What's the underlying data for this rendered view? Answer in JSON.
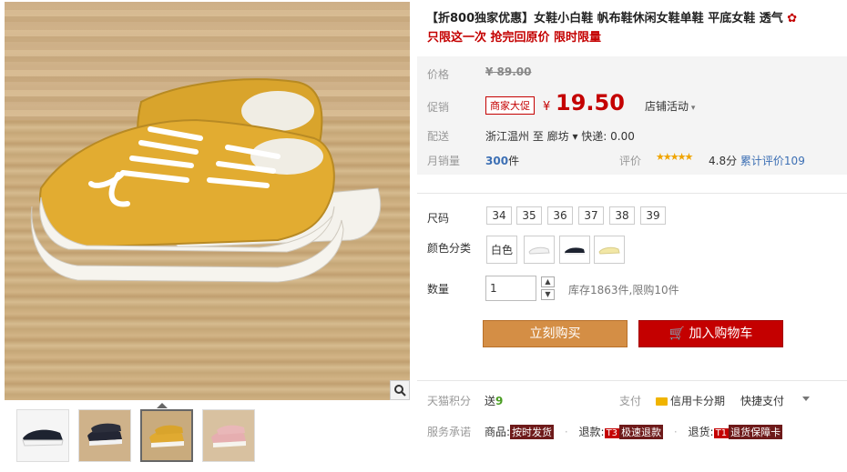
{
  "product": {
    "title": "【折800独家优惠】女鞋小白鞋 帆布鞋休闲女鞋单鞋 平底女鞋 透气",
    "subtitle": "只限这一次 抢完回原价 限时限量"
  },
  "price": {
    "label": "价格",
    "original": "¥ 89.00",
    "promo_label": "促销",
    "promo_tag": "商家大促",
    "yen": "¥",
    "current": "19.50",
    "shop_activity": "店铺活动"
  },
  "shipping": {
    "label": "配送",
    "text": "浙江温州  至  廊坊 ▾  快递: 0.00"
  },
  "sales": {
    "label": "月销量",
    "count": "300",
    "unit": "件",
    "review_label": "评价",
    "stars": "★★★★★",
    "score": "4.8分",
    "total_reviews": "累计评价109"
  },
  "options": {
    "size_label": "尺码",
    "sizes": [
      "34",
      "35",
      "36",
      "37",
      "38",
      "39"
    ],
    "color_label": "颜色分类",
    "color_first": "白色",
    "qty_label": "数量",
    "qty_value": "1",
    "stock_text": "库存1863件,限购10件"
  },
  "actions": {
    "buy_now": "立刻购买",
    "add_cart": "加入购物车"
  },
  "footer": {
    "points_label": "天猫积分",
    "points_prefix": "送",
    "points_value": "9",
    "pay_label": "支付",
    "credit": "信用卡分期",
    "quickpay": "快捷支付",
    "service_label": "服务承诺",
    "svc1_prefix": "商品:",
    "svc1_tag": "按时发货",
    "svc2_prefix": "退款:",
    "svc2_code": "T3",
    "svc2_tag": "极速退款",
    "svc3_prefix": "退货:",
    "svc3_code": "T1",
    "svc3_tag": "退货保障卡"
  },
  "colors": {
    "accent_red": "#c40000",
    "buy_orange": "#d48e45",
    "link_blue": "#3c6fb4"
  }
}
